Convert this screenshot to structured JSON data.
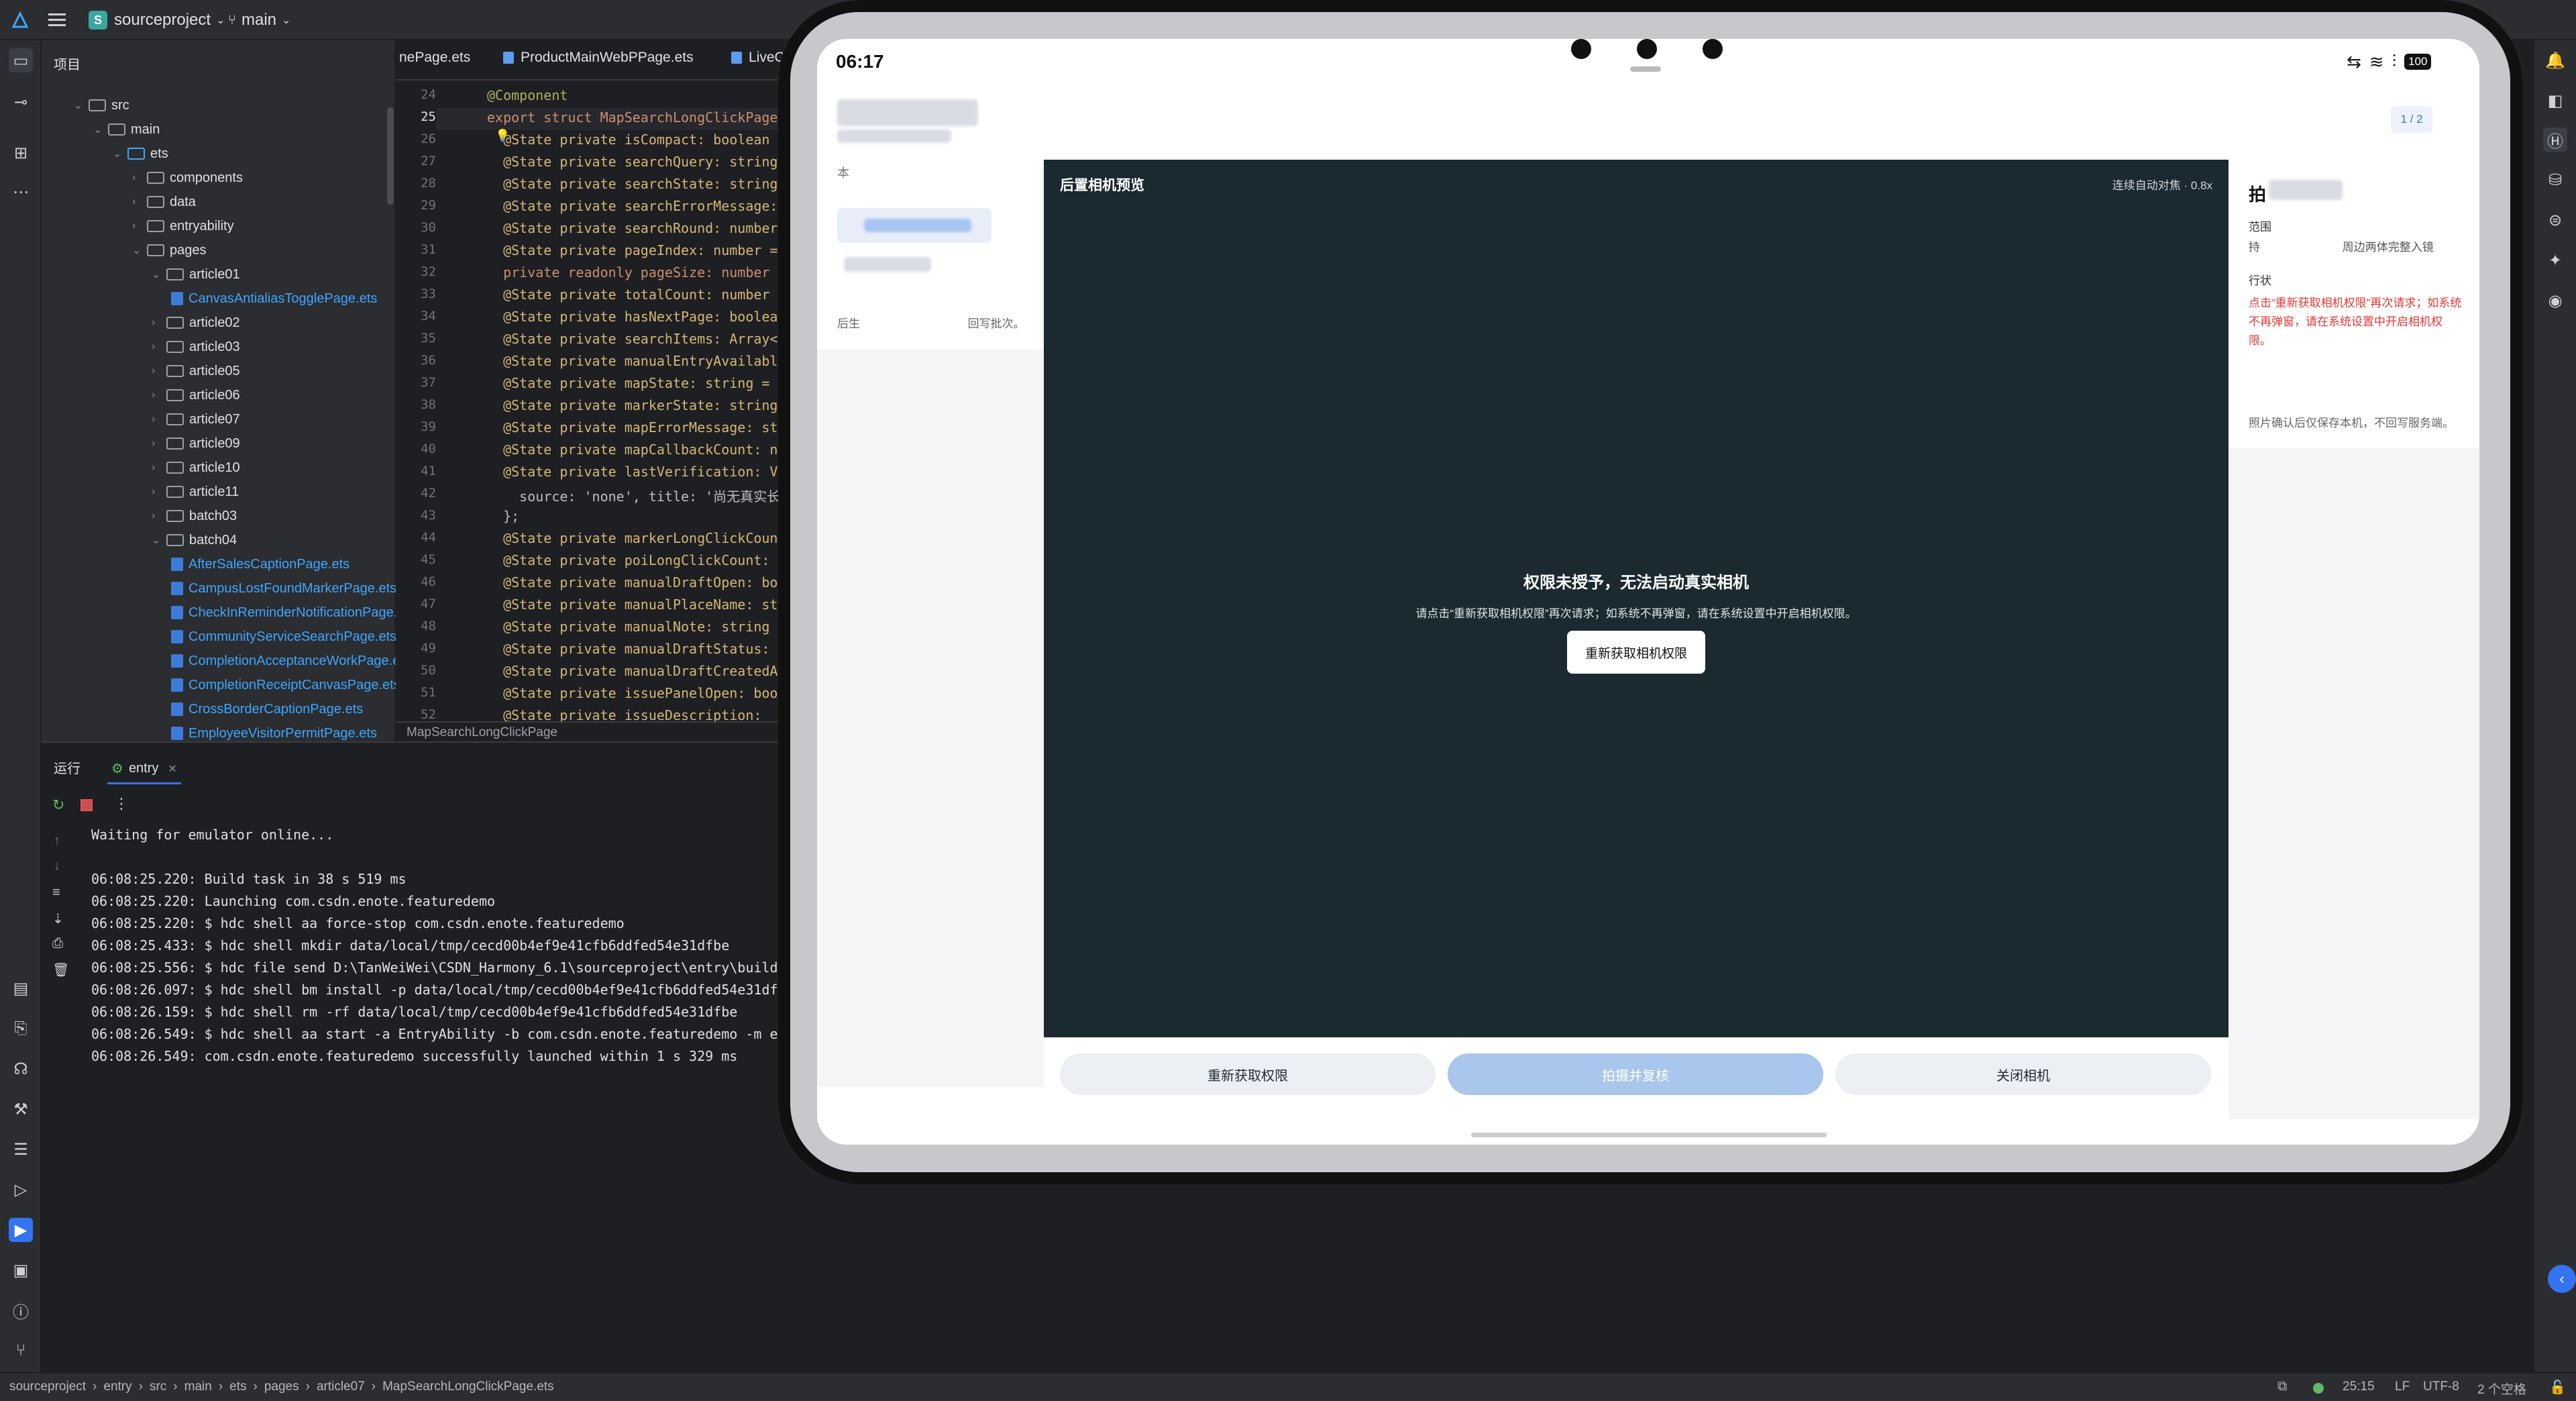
{
  "topbar": {
    "project": "sourceproject",
    "project_badge": "S",
    "branch": "main"
  },
  "tree": {
    "header": "项目",
    "rows": [
      {
        "label": "src",
        "depth": 2,
        "type": "folder",
        "open": true
      },
      {
        "label": "main",
        "depth": 3,
        "type": "folder",
        "open": true
      },
      {
        "label": "ets",
        "depth": 4,
        "type": "folder",
        "open": true
      },
      {
        "label": "components",
        "depth": 5,
        "type": "folder",
        "open": false
      },
      {
        "label": "data",
        "depth": 5,
        "type": "folder",
        "open": false
      },
      {
        "label": "entryability",
        "depth": 5,
        "type": "folder",
        "open": false
      },
      {
        "label": "pages",
        "depth": 5,
        "type": "folder",
        "open": true
      },
      {
        "label": "article01",
        "depth": 6,
        "type": "folder",
        "open": true
      },
      {
        "label": "CanvasAntialiasTogglePage.ets",
        "depth": 7,
        "type": "file"
      },
      {
        "label": "article02",
        "depth": 6,
        "type": "folder",
        "open": false
      },
      {
        "label": "article03",
        "depth": 6,
        "type": "folder",
        "open": false
      },
      {
        "label": "article05",
        "depth": 6,
        "type": "folder",
        "open": false
      },
      {
        "label": "article06",
        "depth": 6,
        "type": "folder",
        "open": false
      },
      {
        "label": "article07",
        "depth": 6,
        "type": "folder",
        "open": false
      },
      {
        "label": "article09",
        "depth": 6,
        "type": "folder",
        "open": false
      },
      {
        "label": "article10",
        "depth": 6,
        "type": "folder",
        "open": false
      },
      {
        "label": "article11",
        "depth": 6,
        "type": "folder",
        "open": false
      },
      {
        "label": "batch03",
        "depth": 6,
        "type": "folder",
        "open": false
      },
      {
        "label": "batch04",
        "depth": 6,
        "type": "folder",
        "open": true
      },
      {
        "label": "AfterSalesCaptionPage.ets",
        "depth": 7,
        "type": "file"
      },
      {
        "label": "CampusLostFoundMarkerPage.ets",
        "depth": 7,
        "type": "file"
      },
      {
        "label": "CheckInReminderNotificationPage.ets",
        "depth": 7,
        "type": "file"
      },
      {
        "label": "CommunityServiceSearchPage.ets",
        "depth": 7,
        "type": "file"
      },
      {
        "label": "CompletionAcceptanceWorkPage.ets",
        "depth": 7,
        "type": "file"
      },
      {
        "label": "CompletionReceiptCanvasPage.ets",
        "depth": 7,
        "type": "file"
      },
      {
        "label": "CrossBorderCaptionPage.ets",
        "depth": 7,
        "type": "file"
      },
      {
        "label": "EmployeeVisitorPermitPage.ets",
        "depth": 7,
        "type": "file"
      }
    ]
  },
  "editor": {
    "tabs": [
      "nePage.ets",
      "ProductMainWebPPage.ets",
      "LiveCo"
    ],
    "breadcrumb": "MapSearchLongClickPage",
    "lines": [
      {
        "n": "24",
        "t": "@Component"
      },
      {
        "n": "25",
        "t": "export struct MapSearchLongClickPage"
      },
      {
        "n": "26",
        "t": "  @State private isCompact: boolean"
      },
      {
        "n": "27",
        "t": "  @State private searchQuery: string"
      },
      {
        "n": "28",
        "t": "  @State private searchState: string"
      },
      {
        "n": "29",
        "t": "  @State private searchErrorMessage:"
      },
      {
        "n": "30",
        "t": "  @State private searchRound: number"
      },
      {
        "n": "31",
        "t": "  @State private pageIndex: number ="
      },
      {
        "n": "32",
        "t": "  private readonly pageSize: number"
      },
      {
        "n": "33",
        "t": "  @State private totalCount: number"
      },
      {
        "n": "34",
        "t": "  @State private hasNextPage: boolea"
      },
      {
        "n": "35",
        "t": "  @State private searchItems: Array<"
      },
      {
        "n": "36",
        "t": "  @State private manualEntryAvailabl"
      },
      {
        "n": "37",
        "t": "  @State private mapState: string ="
      },
      {
        "n": "38",
        "t": "  @State private markerState: string"
      },
      {
        "n": "39",
        "t": "  @State private mapErrorMessage: st"
      },
      {
        "n": "40",
        "t": "  @State private mapCallbackCount: n"
      },
      {
        "n": "41",
        "t": "  @State private lastVerification: V"
      },
      {
        "n": "42",
        "t": "    source: 'none', title: '尚无真实长"
      },
      {
        "n": "43",
        "t": "  };"
      },
      {
        "n": "44",
        "t": "  @State private markerLongClickCoun"
      },
      {
        "n": "45",
        "t": "  @State private poiLongClickCount:"
      },
      {
        "n": "46",
        "t": "  @State private manualDraftOpen: bo"
      },
      {
        "n": "47",
        "t": "  @State private manualPlaceName: st"
      },
      {
        "n": "48",
        "t": "  @State private manualNote: string"
      },
      {
        "n": "49",
        "t": "  @State private manualDraftStatus:"
      },
      {
        "n": "50",
        "t": "  @State private manualDraftCreatedA"
      },
      {
        "n": "51",
        "t": "  @State private issuePanelOpen: boo"
      },
      {
        "n": "52",
        "t": "  @State private issueDescription:"
      }
    ]
  },
  "run": {
    "tab_run": "运行",
    "tab_entry": "entry",
    "lines": [
      "Waiting for emulator online...",
      "",
      "06:08:25.220: Build task in 38 s 519 ms",
      "06:08:25.220: Launching com.csdn.enote.featuredemo",
      "06:08:25.220: $ hdc shell aa force-stop com.csdn.enote.featuredemo",
      "06:08:25.433: $ hdc shell mkdir data/local/tmp/cecd00b4ef9e41cfb6ddfed54e31dfbe",
      "06:08:25.556: $ hdc file send D:\\TanWeiWei\\CSDN_Harmony_6.1\\sourceproject\\entry\\build\\",
      "06:08:26.097: $ hdc shell bm install -p data/local/tmp/cecd00b4ef9e41cfb6ddfed54e31dfb",
      "06:08:26.159: $ hdc shell rm -rf data/local/tmp/cecd00b4ef9e41cfb6ddfed54e31dfbe",
      "06:08:26.549: $ hdc shell aa start -a EntryAbility -b com.csdn.enote.featuredemo -m en",
      "06:08:26.549: com.csdn.enote.featuredemo successfully launched within 1 s 329 ms"
    ]
  },
  "status": {
    "crumbs": [
      "sourceproject",
      "entry",
      "src",
      "main",
      "ets",
      "pages",
      "article07",
      "MapSearchLongClickPage.ets"
    ],
    "position": "25:15",
    "line_sep": "LF",
    "encoding": "UTF-8",
    "indent": "2 个空格"
  },
  "device": {
    "time": "06:17",
    "battery": "100",
    "page_counter": "1 / 2",
    "left_small_1": "本",
    "left_footer": "后生                                  回写批次。",
    "preview_title": "后置相机预览",
    "preview_status": "连续自动对焦 · 0.8x",
    "perm_title": "权限未授予，无法启动真实相机",
    "perm_desc": "请点击“重新获取相机权限”再次请求；如系统不再弹窗，请在系统设置中开启相机权限。",
    "perm_button": "重新获取相机权限",
    "right_title": "拍",
    "right_row1": "范围",
    "right_row2": "持                          周边两体完整入镜",
    "right_row3": "行状",
    "right_error": "点击“重新获取相机权限”再次请求；如系统不再弹窗，请在系统设置中开启相机权限。",
    "right_note": "照片确认后仅保存本机，不回写服务端。",
    "btn_retry": "重新获取权限",
    "btn_capture": "拍摄并复核",
    "btn_close": "关闭相机"
  },
  "colors": {
    "accent": "#3574f0",
    "dark_preview": "#1b2a30",
    "capture_btn": "#a9c6ec",
    "error": "#e53935"
  }
}
